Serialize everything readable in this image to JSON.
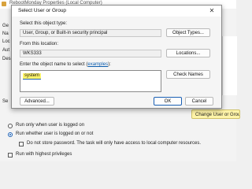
{
  "background_window": {
    "title": "RebootMonday Properties (Local Computer)",
    "side_labels": [
      "Ge",
      "Na",
      "Loc",
      "Aut",
      "Des",
      "Se"
    ],
    "change_user_button": "Change User or Group",
    "options": [
      {
        "type": "radio",
        "label": "Run only when user is logged on",
        "checked": false
      },
      {
        "type": "radio",
        "label": "Run whether user is logged on or not",
        "checked": true
      },
      {
        "type": "checkbox",
        "label": "Do not store password.  The task will only have access to local computer resources.",
        "checked": false
      },
      {
        "type": "checkbox",
        "label": "Run with highest privileges",
        "checked": false
      }
    ]
  },
  "dialog": {
    "title": "Select User or Group",
    "close_glyph": "✕",
    "object_type": {
      "label": "Select this object type:",
      "value": "User, Group, or Built-in security principal",
      "button": "Object Types..."
    },
    "location": {
      "label": "From this location:",
      "value": "WKS333",
      "button": "Locations..."
    },
    "object_names": {
      "label_prefix": "Enter the object name to select (",
      "label_link": "examples",
      "label_suffix": "):",
      "value": "system",
      "button": "Check Names"
    },
    "buttons": {
      "advanced": "Advanced...",
      "ok": "OK",
      "cancel": "Cancel"
    }
  },
  "colors": {
    "highlight_yellow": "#fff46a",
    "accent_blue": "#1a5fb4",
    "link_blue": "#0b5cad"
  }
}
